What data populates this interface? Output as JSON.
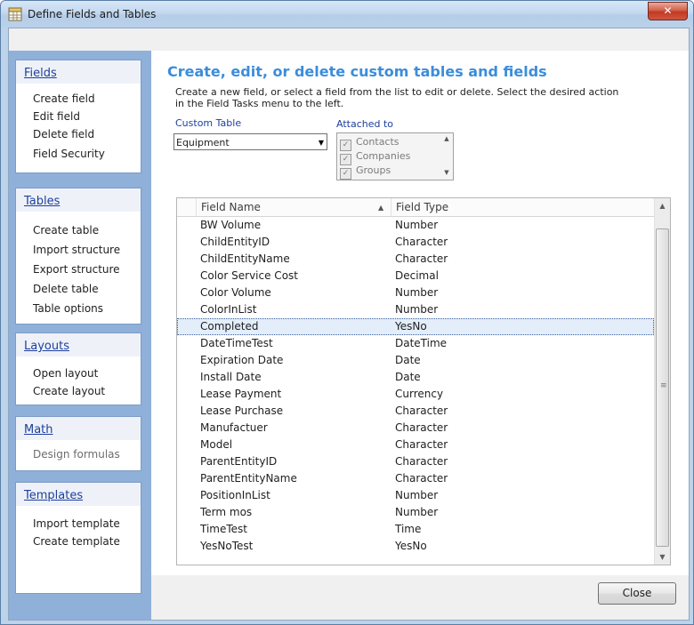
{
  "window": {
    "title": "Define Fields and Tables",
    "close_glyph": "✕"
  },
  "sidebar": {
    "fields": {
      "title": "Fields",
      "items": [
        "Create field",
        "Edit field",
        "Delete field",
        "Field Security"
      ]
    },
    "tables": {
      "title": "Tables",
      "items": [
        "Create table",
        "Import structure",
        "Export structure",
        "Delete table",
        "Table options"
      ]
    },
    "layouts": {
      "title": "Layouts",
      "items": [
        "Open layout",
        "Create layout"
      ]
    },
    "math": {
      "title": "Math",
      "items": [
        "Design formulas"
      ]
    },
    "templates": {
      "title": "Templates",
      "items": [
        "Import template",
        "Create template"
      ]
    }
  },
  "main": {
    "heading": "Create, edit, or delete custom tables and fields",
    "description": "Create a new field, or select a field from the list to edit or delete. Select the desired action in the Field Tasks menu to the left.",
    "custom_table_label": "Custom Table",
    "custom_table_value": "Equipment",
    "attached_label": "Attached to",
    "attached_items": [
      {
        "label": "Contacts",
        "checked": true
      },
      {
        "label": "Companies",
        "checked": true
      },
      {
        "label": "Groups",
        "checked": true
      }
    ]
  },
  "grid": {
    "columns": [
      "Field Name",
      "Field Type"
    ],
    "rows": [
      [
        "BW Volume",
        "Number"
      ],
      [
        "ChildEntityID",
        "Character"
      ],
      [
        "ChildEntityName",
        "Character"
      ],
      [
        "Color Service Cost",
        "Decimal"
      ],
      [
        "Color Volume",
        "Number"
      ],
      [
        "ColorInList",
        "Number"
      ],
      [
        "Completed",
        "YesNo"
      ],
      [
        "DateTimeTest",
        "DateTime"
      ],
      [
        "Expiration Date",
        "Date"
      ],
      [
        "Install Date",
        "Date"
      ],
      [
        "Lease Payment",
        "Currency"
      ],
      [
        "Lease Purchase",
        "Character"
      ],
      [
        "Manufactuer",
        "Character"
      ],
      [
        "Model",
        "Character"
      ],
      [
        "ParentEntityID",
        "Character"
      ],
      [
        "ParentEntityName",
        "Character"
      ],
      [
        "PositionInList",
        "Number"
      ],
      [
        "Term mos",
        "Number"
      ],
      [
        "TimeTest",
        "Time"
      ],
      [
        "YesNoTest",
        "YesNo"
      ]
    ],
    "selected_row": "Completed"
  },
  "footer": {
    "close_label": "Close"
  }
}
